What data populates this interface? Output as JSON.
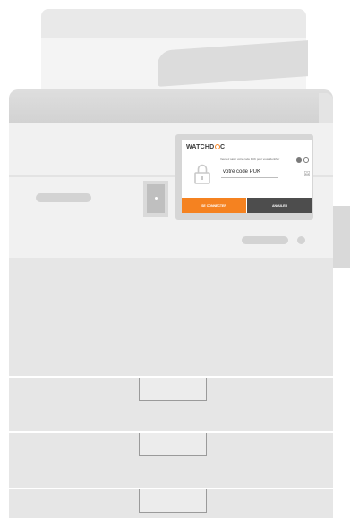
{
  "screen": {
    "logo_left": "WATCHD",
    "logo_right": "C",
    "instruction": "Veuillez saisir votre code PUK pour vous identifier",
    "puk_placeholder": "votre code PUK",
    "connect_label": "SE CONNECTER",
    "cancel_label": "ANNULER"
  },
  "icons": {
    "logo": "watchdoc-logo",
    "lock": "padlock-icon",
    "settings": "gear-icon",
    "info": "info-icon",
    "home": "home-icon"
  },
  "colors": {
    "accent": "#f58220",
    "cancel": "#4d4d4d",
    "device_body": "#e6e6e6"
  }
}
